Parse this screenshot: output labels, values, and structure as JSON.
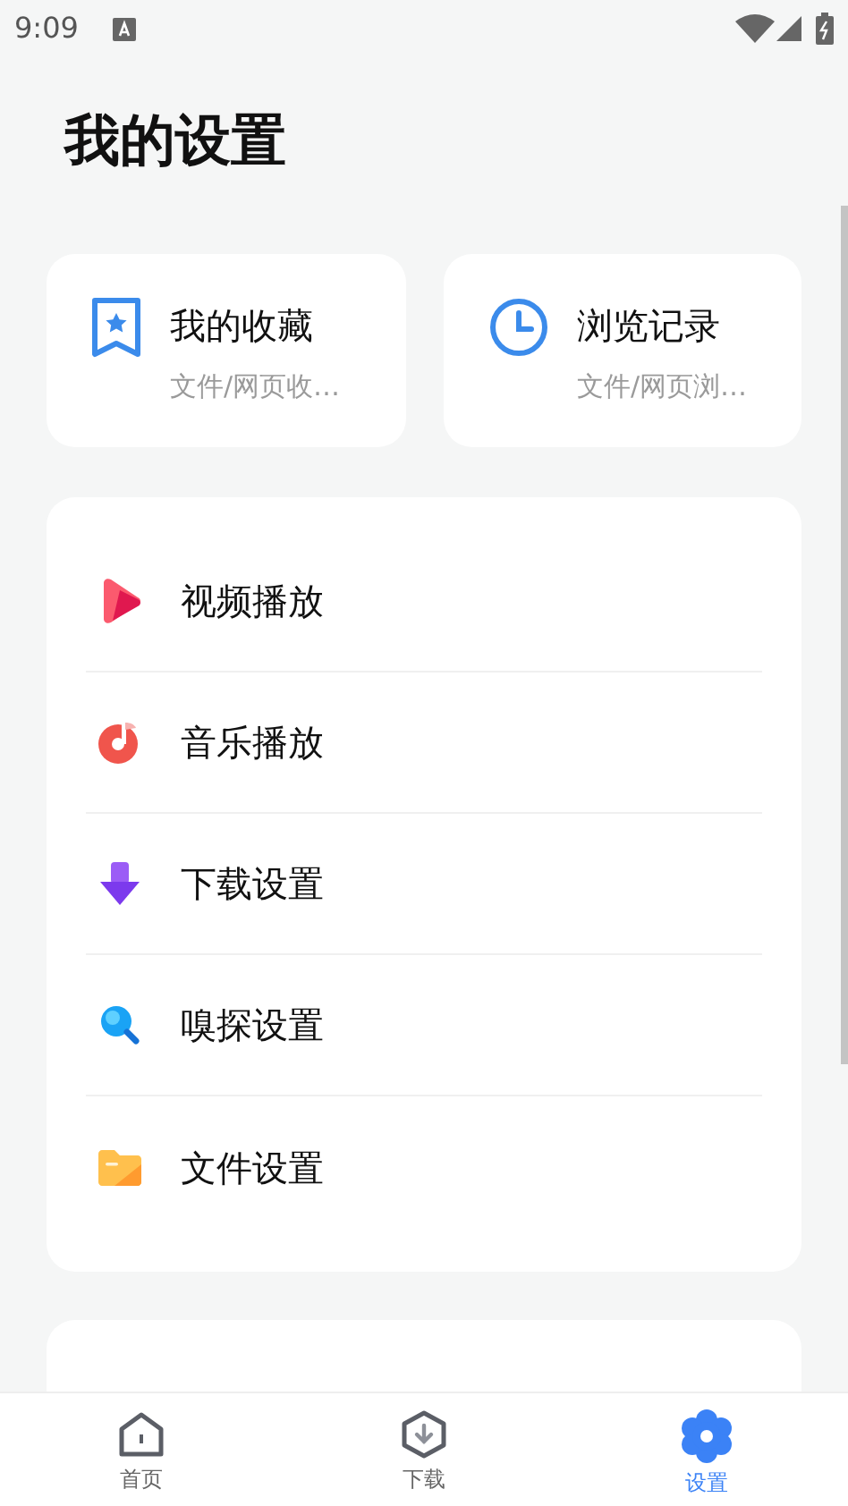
{
  "status_bar": {
    "time": "9:09"
  },
  "title": "我的设置",
  "shortcuts": [
    {
      "kind": "bookmark",
      "title": "我的收藏",
      "subtitle": "文件/网页收…"
    },
    {
      "kind": "history",
      "title": "浏览记录",
      "subtitle": "文件/网页浏…"
    }
  ],
  "settings": [
    {
      "kind": "video",
      "label": "视频播放"
    },
    {
      "kind": "music",
      "label": "音乐播放"
    },
    {
      "kind": "download",
      "label": "下载设置"
    },
    {
      "kind": "sniff",
      "label": "嗅探设置"
    },
    {
      "kind": "file",
      "label": "文件设置"
    }
  ],
  "bottom_nav": [
    {
      "kind": "home",
      "label": "首页",
      "selected": false
    },
    {
      "kind": "download",
      "label": "下载",
      "selected": false
    },
    {
      "kind": "settings",
      "label": "设置",
      "selected": true
    }
  ]
}
